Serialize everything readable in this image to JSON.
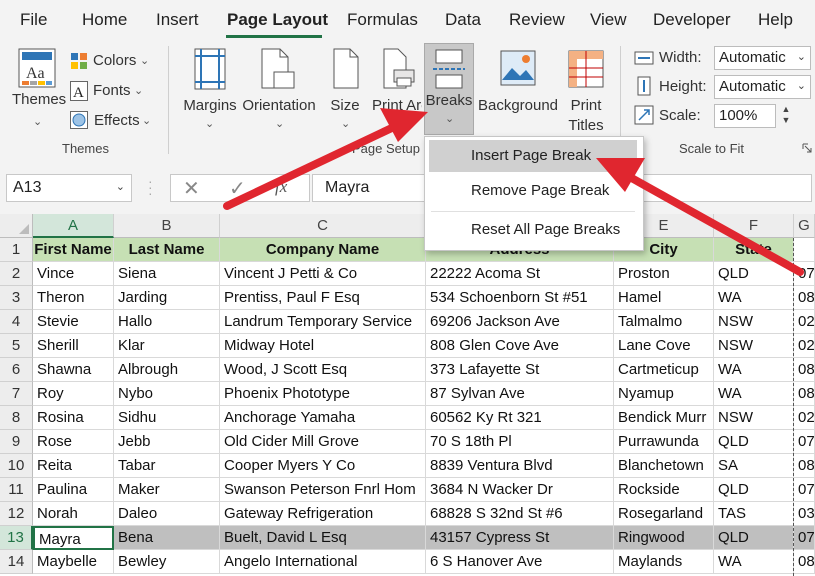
{
  "menu": {
    "tabs": [
      "File",
      "Home",
      "Insert",
      "Page Layout",
      "Formulas",
      "Data",
      "Review",
      "View",
      "Developer",
      "Help"
    ],
    "active_tab": "Page Layout"
  },
  "ribbon": {
    "themes": {
      "themes_label": "Themes",
      "colors_label": "Colors",
      "fonts_label": "Fonts",
      "effects_label": "Effects",
      "group_label": "Themes"
    },
    "page_setup": {
      "margins_label": "Margins",
      "orientation_label": "Orientation",
      "size_label": "Size",
      "print_area_label": "Print Area",
      "breaks_label": "Breaks",
      "background_label": "Background",
      "print_titles_label_1": "Print",
      "print_titles_label_2": "Titles",
      "group_label": "Page Setup"
    },
    "scale_to_fit": {
      "width_label": "Width:",
      "width_value": "Automatic",
      "height_label": "Height:",
      "height_value": "Automatic",
      "scale_label": "Scale:",
      "scale_value": "100%",
      "group_label": "Scale to Fit"
    }
  },
  "formula_bar": {
    "name_box": "A13",
    "fx_label": "fx",
    "value": "Mayra"
  },
  "breaks_menu": {
    "items": [
      "Insert Page Break",
      "Remove Page Break",
      "Reset All Page Breaks"
    ],
    "highlighted": "Insert Page Break"
  },
  "sheet": {
    "columns": [
      "A",
      "B",
      "C",
      "D",
      "E",
      "F",
      "G"
    ],
    "selected_row": 13,
    "active_cell": "A13",
    "rows": [
      {
        "n": "1",
        "cells": [
          "First Name",
          "Last Name",
          "Company Name",
          "Address",
          "City",
          "State",
          ""
        ]
      },
      {
        "n": "2",
        "cells": [
          "Vince",
          "Siena",
          "Vincent J Petti & Co",
          "22222 Acoma St",
          "Proston",
          "QLD",
          "07"
        ]
      },
      {
        "n": "3",
        "cells": [
          "Theron",
          "Jarding",
          "Prentiss, Paul F Esq",
          "534 Schoenborn St #51",
          "Hamel",
          "WA",
          "08"
        ]
      },
      {
        "n": "4",
        "cells": [
          "Stevie",
          "Hallo",
          "Landrum Temporary Service",
          "69206 Jackson Ave",
          "Talmalmo",
          "NSW",
          "02"
        ]
      },
      {
        "n": "5",
        "cells": [
          "Sherill",
          "Klar",
          "Midway Hotel",
          "808 Glen Cove Ave",
          "Lane Cove",
          "NSW",
          "02"
        ]
      },
      {
        "n": "6",
        "cells": [
          "Shawna",
          "Albrough",
          "Wood, J Scott Esq",
          "373 Lafayette St",
          "Cartmeticup",
          "WA",
          "08"
        ]
      },
      {
        "n": "7",
        "cells": [
          "Roy",
          "Nybo",
          "Phoenix Phototype",
          "87 Sylvan Ave",
          "Nyamup",
          "WA",
          "08"
        ]
      },
      {
        "n": "8",
        "cells": [
          "Rosina",
          "Sidhu",
          "Anchorage Yamaha",
          "60562 Ky Rt 321",
          "Bendick Murr",
          "NSW",
          "02"
        ]
      },
      {
        "n": "9",
        "cells": [
          "Rose",
          "Jebb",
          "Old Cider Mill Grove",
          "70 S 18th Pl",
          "Purrawunda",
          "QLD",
          "07"
        ]
      },
      {
        "n": "10",
        "cells": [
          "Reita",
          "Tabar",
          "Cooper Myers Y Co",
          "8839 Ventura Blvd",
          "Blanchetown",
          "SA",
          "08"
        ]
      },
      {
        "n": "11",
        "cells": [
          "Paulina",
          "Maker",
          "Swanson Peterson Fnrl Hom",
          "3684 N Wacker Dr",
          "Rockside",
          "QLD",
          "07"
        ]
      },
      {
        "n": "12",
        "cells": [
          "Norah",
          "Daleo",
          "Gateway Refrigeration",
          "68828 S 32nd St #6",
          "Rosegarland",
          "TAS",
          "03"
        ]
      },
      {
        "n": "13",
        "cells": [
          "Mayra",
          "Bena",
          "Buelt, David L Esq",
          "43157 Cypress St",
          "Ringwood",
          "QLD",
          "07"
        ]
      },
      {
        "n": "14",
        "cells": [
          "Maybelle",
          "Bewley",
          "Angelo International",
          "6 S Hanover Ave",
          "Maylands",
          "WA",
          "08"
        ]
      }
    ]
  },
  "colors": {
    "header_fill": "#c6e0b4",
    "accent_green": "#217346",
    "arrow_red": "#e0262f",
    "selected_row_fill": "#bfbfbf"
  }
}
